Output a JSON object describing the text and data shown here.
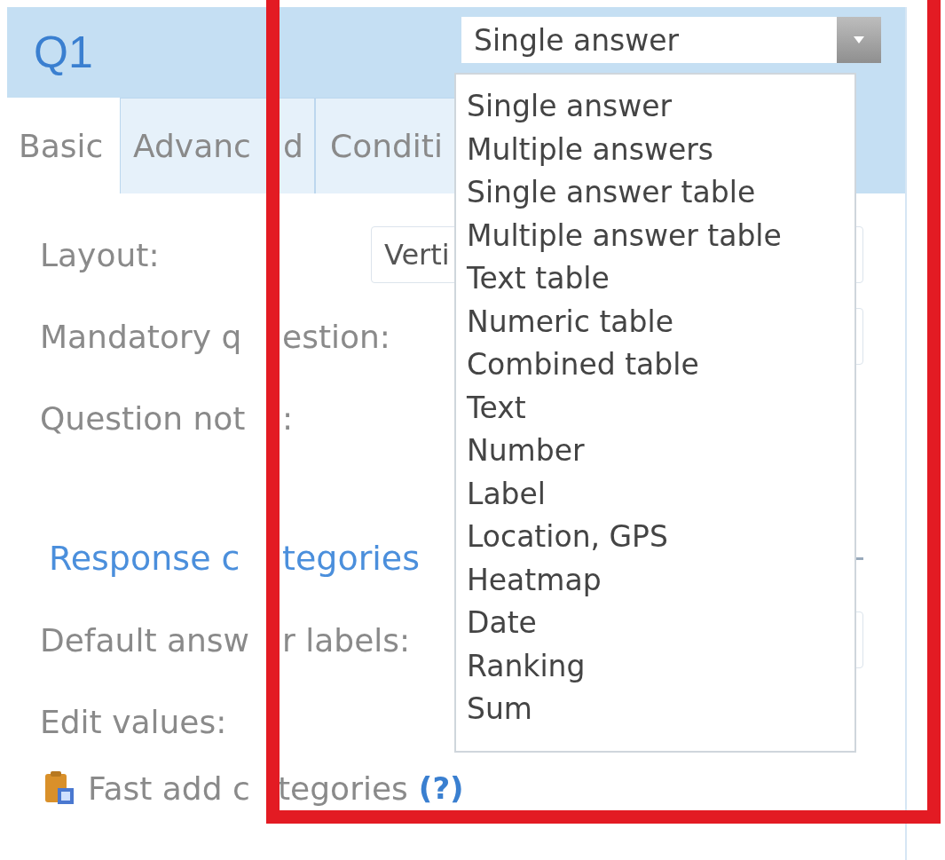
{
  "header": {
    "title": "Q1",
    "type_select": {
      "value": "Single answer",
      "expanded": true
    }
  },
  "tabs": [
    {
      "label_parts": [
        "Basic"
      ],
      "selected": true
    },
    {
      "label_parts": [
        "Advanc",
        "d"
      ],
      "selected": false
    },
    {
      "label_parts": [
        "Conditi"
      ],
      "selected": false
    }
  ],
  "fields": [
    {
      "kind": "select",
      "label_parts": [
        "Layout:"
      ],
      "value": "Verti"
    },
    {
      "kind": "box",
      "label_parts": [
        "Mandatory q",
        "estion:"
      ]
    },
    {
      "kind": "text",
      "label_parts": [
        "Question not",
        ":"
      ]
    }
  ],
  "section": {
    "title_parts": [
      "Response c",
      "tegories"
    ],
    "expanded": true
  },
  "category_fields": [
    {
      "kind": "box",
      "label_parts": [
        "Default answ",
        "r labels:"
      ]
    },
    {
      "kind": "text",
      "label_parts": [
        "Edit values:"
      ]
    }
  ],
  "fast_add": {
    "label_parts": [
      "Fast add c",
      "tegories"
    ],
    "help": "(?)"
  },
  "dropdown": {
    "options": [
      {
        "label": "Single answer",
        "selected": false
      },
      {
        "label": "Multiple answers",
        "selected": false
      },
      {
        "label": "Single answer table",
        "selected": false
      },
      {
        "label": "Multiple answer table",
        "selected": false
      },
      {
        "label": "Text table",
        "selected": false
      },
      {
        "label": "Numeric table",
        "selected": false
      },
      {
        "label": "Combined table",
        "selected": false
      },
      {
        "label": "Text",
        "selected": false
      },
      {
        "label": "Number",
        "selected": false
      },
      {
        "label": "Label",
        "selected": false
      },
      {
        "label": "Location, GPS",
        "selected": false
      },
      {
        "label": "Heatmap",
        "selected": false
      },
      {
        "label": "Date",
        "selected": false
      },
      {
        "label": "Ranking",
        "selected": false
      },
      {
        "label": "Sum",
        "selected": false
      }
    ]
  }
}
